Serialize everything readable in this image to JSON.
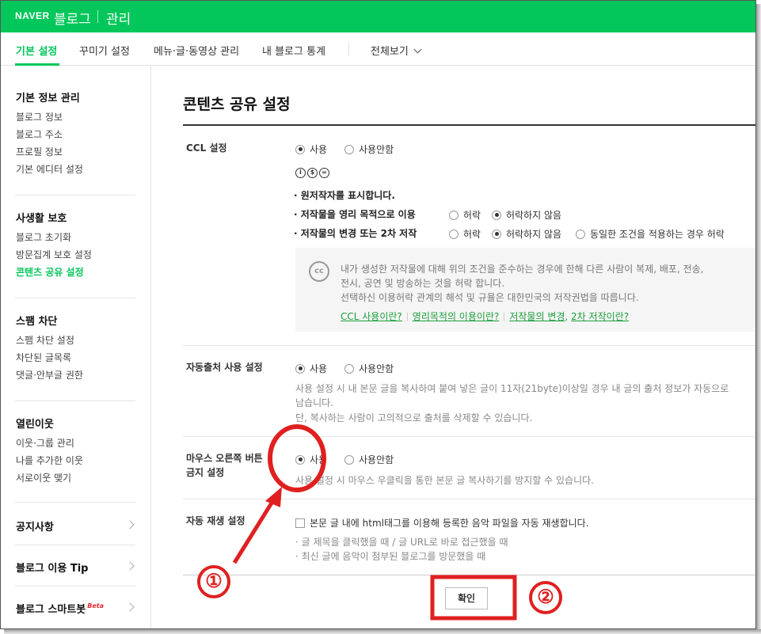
{
  "header": {
    "brand": "NAVER",
    "blog": "블로그",
    "admin": "관리"
  },
  "tabs": [
    {
      "label": "기본 설정",
      "active": true
    },
    {
      "label": "꾸미기 설정"
    },
    {
      "label": "메뉴·글·동영상 관리"
    },
    {
      "label": "내 블로그 통계"
    },
    {
      "label": "전체보기"
    }
  ],
  "sidebar": {
    "groups": [
      {
        "title": "기본 정보 관리",
        "items": [
          "블로그 정보",
          "블로그 주소",
          "프로필 정보",
          "기본 에디터 설정"
        ]
      },
      {
        "title": "사생활 보호",
        "items": [
          "블로그 초기화",
          "방문집계 보호 설정",
          "콘텐츠 공유 설정"
        ]
      },
      {
        "title": "스팸 차단",
        "items": [
          "스팸 차단 설정",
          "차단된 글목록",
          "댓글·안부글 권한"
        ]
      },
      {
        "title": "열린이웃",
        "items": [
          "이웃·그룹 관리",
          "나를 추가한 이웃",
          "서로이웃 맺기"
        ]
      }
    ],
    "links": [
      "공지사항",
      "블로그 이용 Tip",
      "블로그 스마트봇"
    ],
    "beta": "Beta"
  },
  "main": {
    "title": "콘텐츠 공유 설정",
    "ccl": {
      "label": "CCL 설정",
      "use": "사용",
      "nouse": "사용안함",
      "icons": [
        "i",
        "$",
        "="
      ],
      "cond1": "· 원저작자를 표시합니다.",
      "cond2": "· 저작물을 영리 목적으로 이용",
      "cond3": "· 저작물의 변경 또는 2차 저작",
      "allow": "허락",
      "deny": "허락하지 않음",
      "same": "동일한 조건을 적용하는 경우 허락",
      "badge": "cc",
      "info": [
        "내가 생성한 저작물에 대해 위의 조건을 준수하는 경우에 한해 다른 사람이 복제, 배포, 전송,",
        "전시, 공연 및 방송하는 것을 허락 합니다.",
        "선택하신 이용허락 관계의 해석 및 규율은 대한민국의 저작권법을 따릅니다."
      ],
      "links": [
        "CCL 사용이란?",
        "영리목적의 이용이란?",
        "저작물의 변경",
        "2차 저작이란?"
      ]
    },
    "auto_source": {
      "label": "자동출처 사용 설정",
      "use": "사용",
      "nouse": "사용안함",
      "desc": [
        "사용 설정 시 내 본문 글을 복사하여 붙여 넣은 글이 11자(21byte)이상일 경우 내 글의 출처 정보가 자동으로",
        "남습니다.",
        "단, 복사하는 사람이 고의적으로 출처를 삭제할 수 있습니다."
      ]
    },
    "right_click": {
      "label1": "마우스 오른쪽 버튼",
      "label2": "금지 설정",
      "use": "사용",
      "nouse": "사용안함",
      "desc": "사용 설정 시 마우스 우클릭을 통한 본문 글 복사하기를 방지할 수 있습니다."
    },
    "autoplay": {
      "label": "자동 재생 설정",
      "check": "본문 글 내에 html태그를 이용해 등록한 음악 파일을 자동 재생합니다.",
      "desc": [
        "· 글 제목을 클릭했을 때 / 글 URL로 바로 접근했을 때",
        "· 최신 글에 음악이 첨부된 블로그를 방문했을 때"
      ]
    },
    "confirm": "확인"
  },
  "annotations": {
    "num1": "①",
    "num2": "②",
    "color": "#e02020"
  }
}
